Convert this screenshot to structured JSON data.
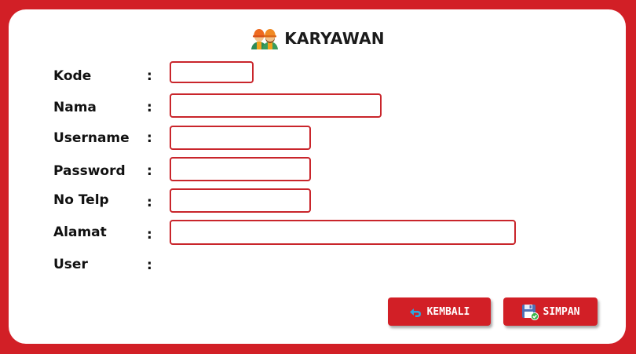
{
  "header": {
    "title": "KARYAWAN",
    "icon": "workers-icon"
  },
  "form": {
    "fields": [
      {
        "label": "Kode",
        "value": ""
      },
      {
        "label": "Nama",
        "value": ""
      },
      {
        "label": "Username",
        "value": ""
      },
      {
        "label": "Password",
        "value": ""
      },
      {
        "label": "No Telp",
        "value": ""
      },
      {
        "label": "Alamat",
        "value": ""
      },
      {
        "label": "User",
        "value": ""
      }
    ],
    "separator": ":"
  },
  "buttons": {
    "back": {
      "label": "KEMBALI",
      "icon": "undo-arrow-icon"
    },
    "save": {
      "label": "SIMPAN",
      "icon": "floppy-disk-check-icon"
    }
  },
  "colors": {
    "accent": "#d21f26",
    "field_border": "#c9252b",
    "back_icon": "#29a9e1"
  }
}
